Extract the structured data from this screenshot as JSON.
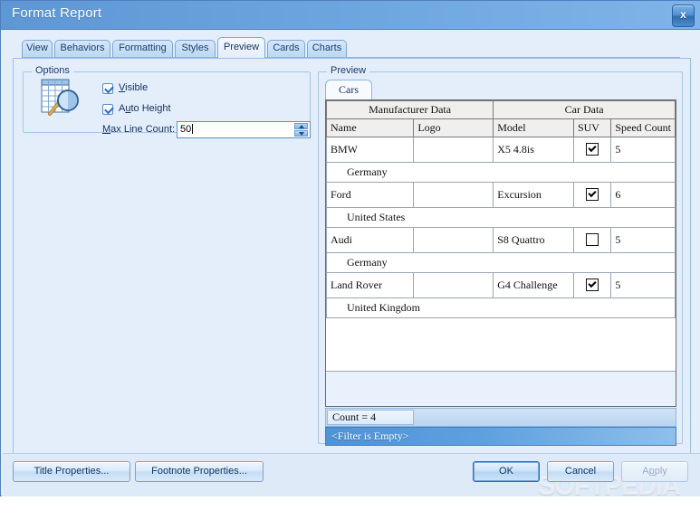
{
  "window": {
    "title": "Format Report",
    "close_label": "x"
  },
  "tabs": [
    {
      "label": "View",
      "selected": false
    },
    {
      "label": "Behaviors",
      "selected": false
    },
    {
      "label": "Formatting",
      "selected": false
    },
    {
      "label": "Styles",
      "selected": false
    },
    {
      "label": "Preview",
      "selected": true
    },
    {
      "label": "Cards",
      "selected": false
    },
    {
      "label": "Charts",
      "selected": false
    }
  ],
  "options": {
    "group_title": "Options",
    "icon": "table-magnifier-icon",
    "visible": {
      "label_pre": "",
      "mnemonic": "V",
      "label_post": "isible",
      "checked": true
    },
    "auto_height": {
      "label_pre": "A",
      "mnemonic": "u",
      "label_post": "to Height",
      "checked": true
    },
    "max_line_count": {
      "label_pre": "M",
      "mnemonic": "M",
      "label_post": "ax Line Count:",
      "label_full": "Max Line Count:",
      "value": "50"
    }
  },
  "preview": {
    "group_title": "Preview",
    "inner_tab": "Cars",
    "grid": {
      "bands": [
        {
          "label": "Manufacturer Data",
          "span": 2
        },
        {
          "label": "Car Data",
          "span": 3
        }
      ],
      "columns": [
        "Name",
        "Logo",
        "Model",
        "SUV",
        "Speed Count"
      ],
      "rows": [
        {
          "name": "BMW",
          "logo": "",
          "model": "X5 4.8is",
          "suv": true,
          "speed_count": "5",
          "group": "Germany"
        },
        {
          "name": "Ford",
          "logo": "",
          "model": "Excursion",
          "suv": true,
          "speed_count": "6",
          "group": "United States"
        },
        {
          "name": "Audi",
          "logo": "",
          "model": "S8 Quattro",
          "suv": false,
          "speed_count": "5",
          "group": "Germany"
        },
        {
          "name": "Land Rover",
          "logo": "",
          "model": "G4 Challenge",
          "suv": true,
          "speed_count": "5",
          "group": "United Kingdom"
        }
      ]
    },
    "count_text": "Count = 4",
    "filter_text": "<Filter is Empty>"
  },
  "footer": {
    "title_properties": "Title Properties...",
    "footnote_properties": "Footnote Properties...",
    "ok": "OK",
    "cancel": "Cancel",
    "apply_pre": "A",
    "apply_mnemonic": "p",
    "apply_post": "ply",
    "apply": "Apply"
  },
  "watermark": {
    "text": "SOFTPEDIA",
    "mark": "°"
  },
  "colors": {
    "titlebar_left": "#5e97d4",
    "titlebar_right": "#7fb4e8",
    "panel_bg": "#e4eefb",
    "accent": "#2f6cb0",
    "filter_bar": "#4f93d8",
    "grid_header": "#f0efee"
  }
}
